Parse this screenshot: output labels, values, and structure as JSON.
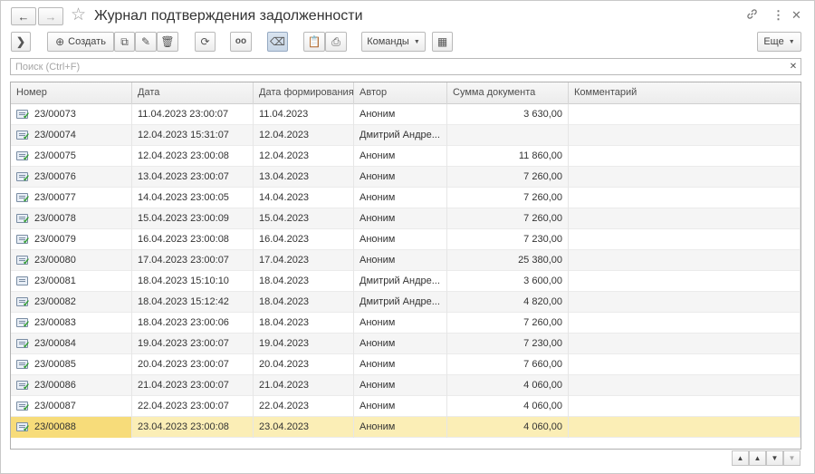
{
  "window": {
    "title": "Журнал подтверждения задолженности"
  },
  "toolbar": {
    "create_label": "Создать",
    "commands_label": "Команды",
    "more_label": "Еще"
  },
  "search": {
    "placeholder": "Поиск (Ctrl+F)",
    "value": ""
  },
  "table": {
    "columns": [
      "Номер",
      "Дата",
      "Дата формирования",
      "Автор",
      "Сумма документа",
      "Комментарий"
    ],
    "rows": [
      {
        "number": "23/00073",
        "date": "11.04.2023 23:00:07",
        "formed": "11.04.2023",
        "author": "Аноним",
        "sum": "3 630,00",
        "comment": "",
        "posted": true
      },
      {
        "number": "23/00074",
        "date": "12.04.2023 15:31:07",
        "formed": "12.04.2023",
        "author": "Дмитрий Андре...",
        "sum": "",
        "comment": "",
        "posted": true
      },
      {
        "number": "23/00075",
        "date": "12.04.2023 23:00:08",
        "formed": "12.04.2023",
        "author": "Аноним",
        "sum": "11 860,00",
        "comment": "",
        "posted": true
      },
      {
        "number": "23/00076",
        "date": "13.04.2023 23:00:07",
        "formed": "13.04.2023",
        "author": "Аноним",
        "sum": "7 260,00",
        "comment": "",
        "posted": true
      },
      {
        "number": "23/00077",
        "date": "14.04.2023 23:00:05",
        "formed": "14.04.2023",
        "author": "Аноним",
        "sum": "7 260,00",
        "comment": "",
        "posted": true
      },
      {
        "number": "23/00078",
        "date": "15.04.2023 23:00:09",
        "formed": "15.04.2023",
        "author": "Аноним",
        "sum": "7 260,00",
        "comment": "",
        "posted": true
      },
      {
        "number": "23/00079",
        "date": "16.04.2023 23:00:08",
        "formed": "16.04.2023",
        "author": "Аноним",
        "sum": "7 230,00",
        "comment": "",
        "posted": true
      },
      {
        "number": "23/00080",
        "date": "17.04.2023 23:00:07",
        "formed": "17.04.2023",
        "author": "Аноним",
        "sum": "25 380,00",
        "comment": "",
        "posted": true
      },
      {
        "number": "23/00081",
        "date": "18.04.2023 15:10:10",
        "formed": "18.04.2023",
        "author": "Дмитрий Андре...",
        "sum": "3 600,00",
        "comment": "",
        "posted": false
      },
      {
        "number": "23/00082",
        "date": "18.04.2023 15:12:42",
        "formed": "18.04.2023",
        "author": "Дмитрий Андре...",
        "sum": "4 820,00",
        "comment": "",
        "posted": true
      },
      {
        "number": "23/00083",
        "date": "18.04.2023 23:00:06",
        "formed": "18.04.2023",
        "author": "Аноним",
        "sum": "7 260,00",
        "comment": "",
        "posted": true
      },
      {
        "number": "23/00084",
        "date": "19.04.2023 23:00:07",
        "formed": "19.04.2023",
        "author": "Аноним",
        "sum": "7 230,00",
        "comment": "",
        "posted": true
      },
      {
        "number": "23/00085",
        "date": "20.04.2023 23:00:07",
        "formed": "20.04.2023",
        "author": "Аноним",
        "sum": "7 660,00",
        "comment": "",
        "posted": true
      },
      {
        "number": "23/00086",
        "date": "21.04.2023 23:00:07",
        "formed": "21.04.2023",
        "author": "Аноним",
        "sum": "4 060,00",
        "comment": "",
        "posted": true
      },
      {
        "number": "23/00087",
        "date": "22.04.2023 23:00:07",
        "formed": "22.04.2023",
        "author": "Аноним",
        "sum": "4 060,00",
        "comment": "",
        "posted": true
      },
      {
        "number": "23/00088",
        "date": "23.04.2023 23:00:08",
        "formed": "23.04.2023",
        "author": "Аноним",
        "sum": "4 060,00",
        "comment": "",
        "posted": true,
        "selected": true
      }
    ]
  },
  "colors": {
    "selected_row": "#fbeeb6",
    "selected_cell": "#f7dc7a",
    "posted_check": "#2e9b2e"
  }
}
